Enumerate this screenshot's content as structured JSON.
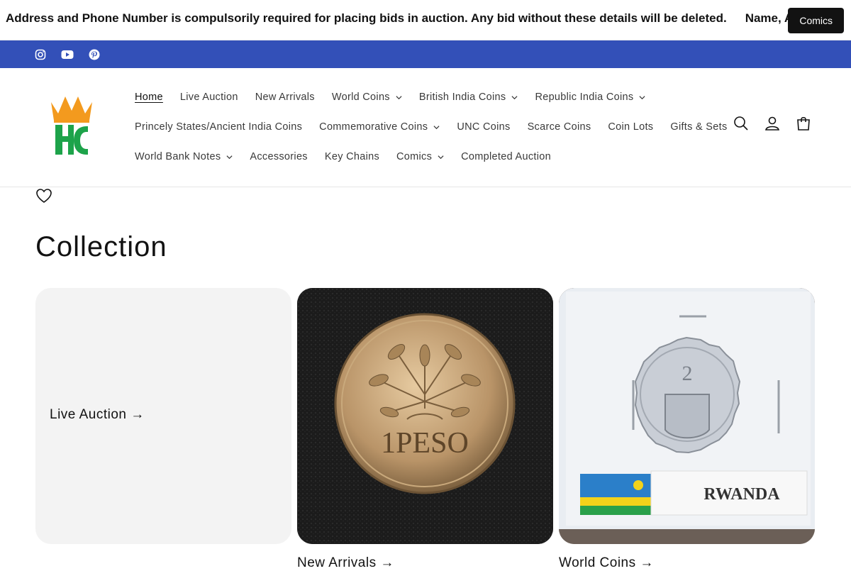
{
  "announcement": {
    "text": "Address and Phone Number is compulsorily required for placing bids in auction. Any bid without these details will be deleted.",
    "text_repeat": "Name, Ad",
    "button_label": "Comics"
  },
  "social": {
    "color": "#3350b8",
    "icons": [
      "instagram-icon",
      "youtube-icon",
      "pinterest-icon"
    ]
  },
  "nav": {
    "row1": [
      {
        "label": "Home",
        "active": true
      },
      {
        "label": "Live Auction"
      },
      {
        "label": "New Arrivals"
      },
      {
        "label": "World Coins",
        "dropdown": true
      },
      {
        "label": "British India Coins",
        "dropdown": true
      },
      {
        "label": "Republic India Coins",
        "dropdown": true
      }
    ],
    "row2": [
      {
        "label": "Princely States/Ancient India Coins"
      },
      {
        "label": "Commemorative Coins",
        "dropdown": true
      },
      {
        "label": "UNC Coins"
      },
      {
        "label": "Scarce Coins"
      },
      {
        "label": "Coin Lots"
      },
      {
        "label": "Gifts & Sets"
      }
    ],
    "row3": [
      {
        "label": "World Bank Notes",
        "dropdown": true
      },
      {
        "label": "Accessories"
      },
      {
        "label": "Key Chains"
      },
      {
        "label": "Comics",
        "dropdown": true
      },
      {
        "label": "Completed Auction"
      }
    ]
  },
  "header_icons": [
    "search-icon",
    "account-icon",
    "cart-icon"
  ],
  "collection": {
    "title": "Collection",
    "cards": [
      {
        "label": "Live Auction →"
      },
      {
        "label": "New Arrivals →",
        "coin_text": "1PESO"
      },
      {
        "label": "World Coins →",
        "coin_text": "RWANDA"
      }
    ]
  }
}
